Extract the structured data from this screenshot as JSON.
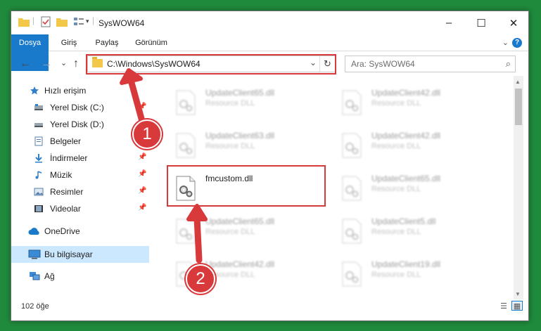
{
  "window": {
    "title": "SysWOW64",
    "controls": {
      "minimize": "–",
      "maximize": "☐",
      "close": "✕"
    }
  },
  "ribbon": {
    "tabs": [
      "Dosya",
      "Giriş",
      "Paylaş",
      "Görünüm"
    ],
    "help": "?"
  },
  "navigation": {
    "back": "←",
    "forward": "→",
    "recent": "⌄",
    "up": "↑",
    "address_path": "C:\\Windows\\SysWOW64",
    "refresh": "↻",
    "search_placeholder": "Ara: SysWOW64"
  },
  "sidebar": {
    "items": [
      {
        "label": "Hızlı erişim",
        "icon": "star-icon",
        "pinned": false
      },
      {
        "label": "Yerel Disk (C:)",
        "icon": "drive-icon",
        "pinned": true
      },
      {
        "label": "Yerel Disk (D:)",
        "icon": "drive-icon",
        "pinned": true
      },
      {
        "label": "Belgeler",
        "icon": "documents-icon",
        "pinned": true
      },
      {
        "label": "İndirmeler",
        "icon": "download-icon",
        "pinned": true
      },
      {
        "label": "Müzik",
        "icon": "music-icon",
        "pinned": true
      },
      {
        "label": "Resimler",
        "icon": "pictures-icon",
        "pinned": true
      },
      {
        "label": "Videolar",
        "icon": "videos-icon",
        "pinned": true
      },
      {
        "label": "OneDrive",
        "icon": "cloud-icon",
        "pinned": false
      },
      {
        "label": "Bu bilgisayar",
        "icon": "computer-icon",
        "pinned": false,
        "selected": true
      },
      {
        "label": "Ağ",
        "icon": "network-icon",
        "pinned": false
      }
    ]
  },
  "files": {
    "items": [
      {
        "name": "UpdateClient65.dll",
        "type": "Resource DLL"
      },
      {
        "name": "UpdateClient42.dll",
        "type": "Resource DLL"
      },
      {
        "name": "UpdateClient63.dll",
        "type": "Resource DLL"
      },
      {
        "name": "UpdateClient42.dll",
        "type": "Resource DLL"
      },
      {
        "name": "fmcustom.dll",
        "type": ""
      },
      {
        "name": "UpdateClient65.dll",
        "type": "Resource DLL"
      },
      {
        "name": "UpdateClient65.dll",
        "type": "Resource DLL"
      },
      {
        "name": "UpdateClient5.dll",
        "type": "Resource DLL"
      },
      {
        "name": "UpdateClient42.dll",
        "type": "Resource DLL"
      },
      {
        "name": "UpdateClient19.dll",
        "type": "Resource DLL"
      }
    ]
  },
  "status": {
    "item_count": "102 öğe"
  },
  "annotations": {
    "step1": "1",
    "step2": "2",
    "color": "#d8393b"
  },
  "colors": {
    "accent": "#1979ca",
    "background": "#1f8a3c",
    "selection": "#cce8ff"
  }
}
